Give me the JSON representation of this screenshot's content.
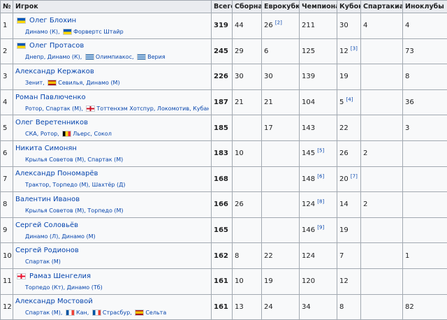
{
  "headers": {
    "num": "№",
    "player": "Игрок",
    "total": "Всего",
    "national": "Сборная",
    "eurocups": "Еврокубки",
    "championship": "Чемпионат",
    "cup": "Кубок",
    "spartakiads": "Спартакиады",
    "foreign": "Иноклубы"
  },
  "rows": [
    {
      "num": "1",
      "flag": "ua",
      "name": "Олег Блохин",
      "clubs_pre": "Динамо (К),",
      "clubs_flags": [
        {
          "flag": "ua",
          "text": "Форвертс Штайр"
        }
      ],
      "total": "319",
      "national": "44",
      "eurocups": "26",
      "eurocups_ref": "[2]",
      "championship": "211",
      "championship_ref": "",
      "cup": "30",
      "cup_ref": "",
      "spartakiads": "4",
      "foreign": "4"
    },
    {
      "num": "2",
      "flag": "ua",
      "name": "Олег Протасов",
      "clubs_pre": "Днепр, Динамо (К),",
      "clubs_flags": [
        {
          "flag": "greece",
          "text": "Олимпиакос,"
        },
        {
          "flag": "greece",
          "text": "Верия"
        }
      ],
      "total": "245",
      "national": "29",
      "eurocups": "6",
      "eurocups_ref": "",
      "championship": "125",
      "championship_ref": "",
      "cup": "12",
      "cup_ref": "[3]",
      "spartakiads": "",
      "foreign": "73"
    },
    {
      "num": "3",
      "flag": "",
      "name": "Александр Кержаков",
      "clubs_pre": "Зенит,",
      "clubs_flags": [
        {
          "flag": "spain",
          "text": "Севилья, Динамо (М)"
        }
      ],
      "total": "226",
      "national": "30",
      "eurocups": "30",
      "eurocups_ref": "",
      "championship": "139",
      "championship_ref": "",
      "cup": "19",
      "cup_ref": "",
      "spartakiads": "",
      "foreign": "8"
    },
    {
      "num": "4",
      "flag": "",
      "name": "Роман Павлюченко",
      "clubs_pre": "Ротор, Спартак (М),",
      "clubs_flags": [
        {
          "flag": "england",
          "text": "Тоттенхэм Хотспур, Локомотив, Кубань, Урал"
        }
      ],
      "total": "187",
      "national": "21",
      "eurocups": "21",
      "eurocups_ref": "",
      "championship": "104",
      "championship_ref": "",
      "cup": "5",
      "cup_ref": "[4]",
      "spartakiads": "",
      "foreign": "36"
    },
    {
      "num": "5",
      "flag": "",
      "name": "Олег Веретенников",
      "clubs_pre": "СКА, Ротор,",
      "clubs_flags": [
        {
          "flag": "belgium",
          "text": "Льерс, Сокол"
        }
      ],
      "total": "185",
      "national": "",
      "eurocups": "17",
      "eurocups_ref": "",
      "championship": "143",
      "championship_ref": "",
      "cup": "22",
      "cup_ref": "",
      "spartakiads": "",
      "foreign": "3"
    },
    {
      "num": "6",
      "flag": "",
      "name": "Никита Симонян",
      "clubs_pre": "Крылья Советов (М), Спартак (М)",
      "clubs_flags": [],
      "total": "183",
      "national": "10",
      "eurocups": "",
      "eurocups_ref": "",
      "championship": "145",
      "championship_ref": "[5]",
      "cup": "26",
      "cup_ref": "",
      "spartakiads": "2",
      "foreign": ""
    },
    {
      "num": "7",
      "flag": "",
      "name": "Александр Пономарёв",
      "clubs_pre": "Трактор, Торпедо (М), Шахтёр (Д)",
      "clubs_flags": [],
      "total": "168",
      "national": "",
      "eurocups": "",
      "eurocups_ref": "",
      "championship": "148",
      "championship_ref": "[6]",
      "cup": "20",
      "cup_ref": "[7]",
      "spartakiads": "",
      "foreign": ""
    },
    {
      "num": "8",
      "flag": "",
      "name": "Валентин Иванов",
      "clubs_pre": "Крылья Советов (М), Торпедо (М)",
      "clubs_flags": [],
      "total": "166",
      "national": "26",
      "eurocups": "",
      "eurocups_ref": "",
      "championship": "124",
      "championship_ref": "[8]",
      "cup": "14",
      "cup_ref": "",
      "spartakiads": "2",
      "foreign": ""
    },
    {
      "num": "9",
      "flag": "",
      "name": "Сергей Соловьёв",
      "clubs_pre": "Динамо (Л), Динамо (М)",
      "clubs_flags": [],
      "total": "165",
      "national": "",
      "eurocups": "",
      "eurocups_ref": "",
      "championship": "146",
      "championship_ref": "[9]",
      "cup": "19",
      "cup_ref": "",
      "spartakiads": "",
      "foreign": ""
    },
    {
      "num": "10",
      "flag": "",
      "name": "Сергей Родионов",
      "clubs_pre": "Спартак (М)",
      "clubs_flags": [],
      "total": "162",
      "national": "8",
      "eurocups": "22",
      "eurocups_ref": "",
      "championship": "124",
      "championship_ref": "",
      "cup": "7",
      "cup_ref": "",
      "spartakiads": "",
      "foreign": "1"
    },
    {
      "num": "11",
      "flag": "ge",
      "name": "Рамаз Шенгелия",
      "clubs_pre": "Торпедо (Кт), Динамо (Тб)",
      "clubs_flags": [],
      "total": "161",
      "national": "10",
      "eurocups": "19",
      "eurocups_ref": "",
      "championship": "120",
      "championship_ref": "",
      "cup": "12",
      "cup_ref": "",
      "spartakiads": "",
      "foreign": ""
    },
    {
      "num": "12",
      "flag": "",
      "name": "Александр Мостовой",
      "clubs_pre": "Спартак (М),",
      "clubs_flags": [
        {
          "flag": "france",
          "text": "Кан,"
        },
        {
          "flag": "france",
          "text": "Страсбур,"
        },
        {
          "flag": "spain",
          "text": "Сельта"
        }
      ],
      "total": "161",
      "national": "13",
      "eurocups": "24",
      "eurocups_ref": "",
      "championship": "34",
      "championship_ref": "",
      "cup": "8",
      "cup_ref": "",
      "spartakiads": "",
      "foreign": "82"
    }
  ]
}
